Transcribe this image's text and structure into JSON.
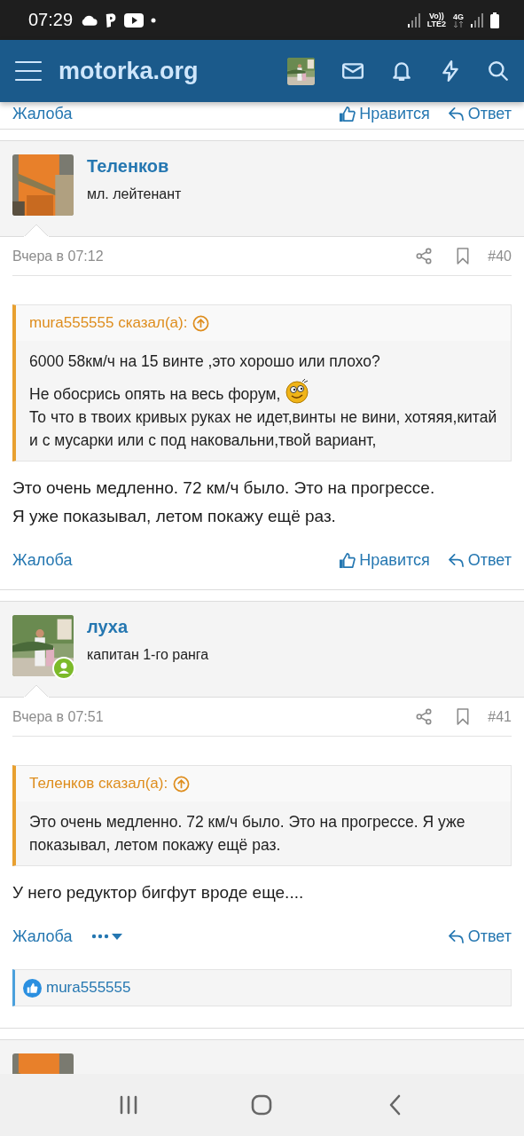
{
  "status_bar": {
    "time": "07:29",
    "volte_label": "Vo))",
    "lte_label": "LTE2",
    "network_label": "4G"
  },
  "header": {
    "title": "motorka.org"
  },
  "top_actions": [
    {
      "kind": "report",
      "label": "Жалоба"
    },
    {
      "kind": "like",
      "label": "Нравится"
    },
    {
      "kind": "reply",
      "label": "Ответ"
    }
  ],
  "posts": [
    {
      "author": "Теленков",
      "rank": "мл. лейтенант",
      "online": false,
      "date": "Вчера в 07:12",
      "number": "#40",
      "quote": {
        "source": "mura555555 сказал(а):",
        "paragraphs": [
          [
            {
              "text": "6000 58км/ч на 15 винте ,это хорошо или плохо?",
              "smiley": false
            }
          ],
          [
            {
              "text": "Не обосрись опять на весь форум,",
              "smiley": true
            },
            {
              "text": "То что в твоих кривых руках не идет,винты не вини, хотяяя,китай и с мусарки или с под наковальни,твой вариант,",
              "smiley": false
            }
          ]
        ]
      },
      "message": "Это очень медленно. 72 км/ч было. Это на прогрессе.\nЯ уже показывал, летом покажу ещё раз.",
      "actions": [
        {
          "kind": "report",
          "label": "Жалоба"
        },
        {
          "kind": "like",
          "label": "Нравится"
        },
        {
          "kind": "reply",
          "label": "Ответ"
        }
      ]
    },
    {
      "author": "луха",
      "rank": "капитан 1-го ранга",
      "online": true,
      "date": "Вчера в 07:51",
      "number": "#41",
      "quote": {
        "source": "Теленков сказал(а):",
        "paragraphs": [
          [
            {
              "text": "Это очень медленно. 72 км/ч было. Это на прогрессе. Я уже показывал, летом покажу ещё раз.",
              "smiley": false
            }
          ]
        ]
      },
      "message": "У него редуктор бигфут вроде еще....",
      "actions": [
        {
          "kind": "report",
          "label": "Жалоба"
        },
        {
          "kind": "more"
        },
        {
          "kind": "reply",
          "label": "Ответ"
        }
      ],
      "reactions": {
        "users": "mura555555"
      }
    }
  ]
}
